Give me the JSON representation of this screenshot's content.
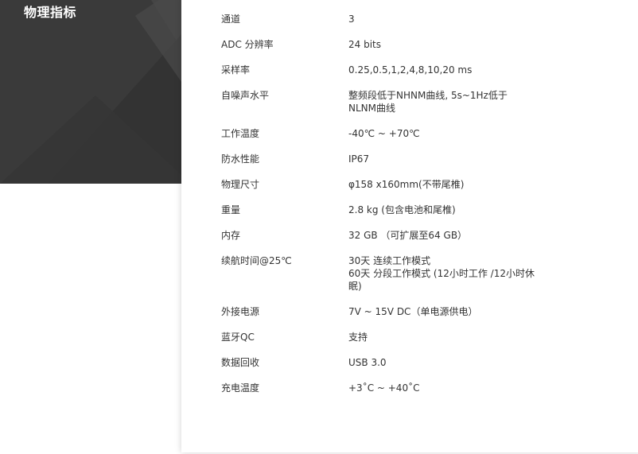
{
  "hero": {
    "title": "物理指标"
  },
  "specs": [
    {
      "label": "通道",
      "value": [
        "3"
      ]
    },
    {
      "label": "ADC 分辨率",
      "value": [
        "24 bits"
      ]
    },
    {
      "label": "采样率",
      "value": [
        "0.25,0.5,1,2,4,8,10,20 ms"
      ]
    },
    {
      "label": "自噪声水平",
      "value": [
        "整频段低于NHNM曲线, 5s~1Hz低于",
        "NLNM曲线"
      ]
    },
    {
      "label": "工作温度",
      "value": [
        "-40℃ ~ +70℃"
      ]
    },
    {
      "label": "防水性能",
      "value": [
        "IP67"
      ]
    },
    {
      "label": "物理尺寸",
      "value": [
        "φ158 x160mm(不带尾椎)"
      ]
    },
    {
      "label": "重量",
      "value": [
        "2.8 kg (包含电池和尾椎)"
      ]
    },
    {
      "label": "内存",
      "value": [
        "32 GB （可扩展至64 GB）"
      ]
    },
    {
      "label": "续航时间@25℃",
      "value": [
        "30天 连续工作模式",
        "60天 分段工作模式 (12小时工作 /12小时休",
        "眠)"
      ]
    },
    {
      "label": "外接电源",
      "value": [
        "7V ~ 15V DC（单电源供电）"
      ]
    },
    {
      "label": "蓝牙QC",
      "value": [
        "支持"
      ]
    },
    {
      "label": "数据回收",
      "value": [
        "USB 3.0"
      ]
    },
    {
      "label": "充电温度",
      "value": [
        "+3˚C ~ +40˚C"
      ]
    }
  ]
}
